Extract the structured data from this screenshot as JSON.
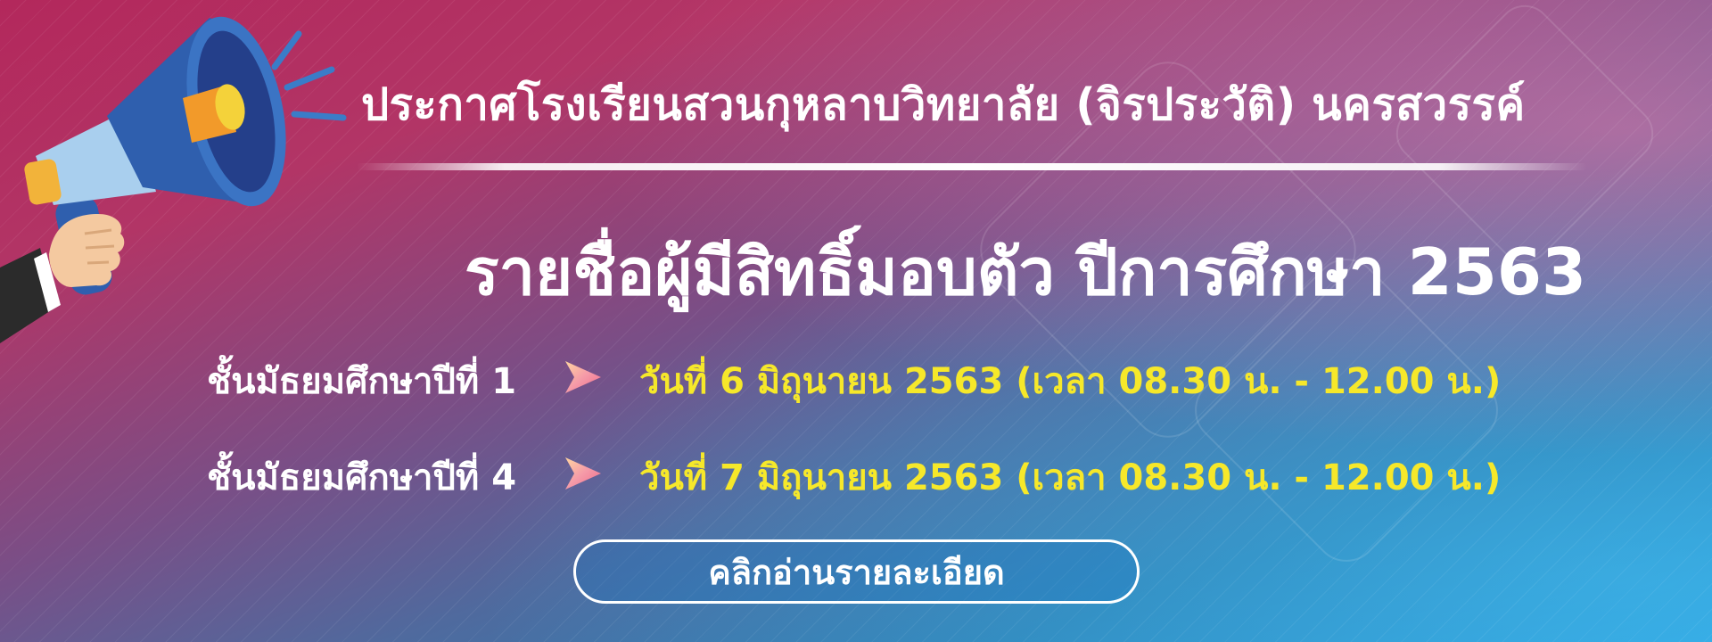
{
  "banner": {
    "title": "ประกาศโรงเรียนสวนกุหลาบวิทยาลัย (จิรประวัติ) นครสวรรค์",
    "subtitle": "รายชื่อผู้มีสิทธิ์มอบตัว ปีการศึกษา 2563",
    "schedule": [
      {
        "grade": "ชั้นมัธยมศึกษาปีที่ 1",
        "date": "วันที่ 6 มิถุนายน 2563 (เวลา 08.30 น. - 12.00 น.)",
        "icon": "arrow-right-icon"
      },
      {
        "grade": "ชั้นมัธยมศึกษาปีที่ 4",
        "date": "วันที่ 7 มิถุนายน 2563 (เวลา 08.30 น. - 12.00 น.)",
        "icon": "arrow-right-icon"
      }
    ],
    "cta_label": "คลิกอ่านรายละเอียด",
    "decoration_icon": "megaphone-icon"
  },
  "colors": {
    "background_top": "#b3285c",
    "background_bottom": "#2aa0de",
    "title_text": "#ffffff",
    "date_text": "#f6e82a",
    "megaphone_blue": "#2f5fae",
    "megaphone_orange": "#f29a2a"
  }
}
